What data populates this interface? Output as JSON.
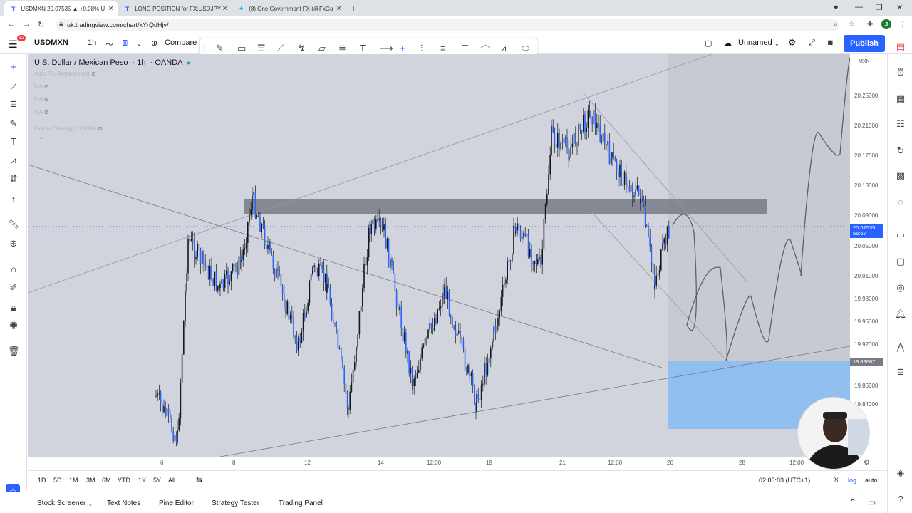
{
  "browser": {
    "tabs": [
      {
        "label": "USDMXN 20.07535 ▲ +0.08% U",
        "icon": "tradingview-icon",
        "active": true
      },
      {
        "label": "LONG POSITION for FX:USDJPY",
        "icon": "tradingview-icon",
        "active": false
      },
      {
        "label": "(8) One Government FX (@FxGo",
        "icon": "twitter-icon",
        "active": false
      }
    ],
    "url": "uk.tradingview.com/chart/xYrQdHjv/",
    "profile_initial": "J"
  },
  "toolbar": {
    "symbol": "USDMXN",
    "interval": "1h",
    "compare_label": "Compare",
    "layout_name": "Unnamed",
    "publish_label": "Publish",
    "alert_badge": "12"
  },
  "legend": {
    "title": "U.S. Dollar / Mexican Peso",
    "interval": "1h",
    "broker": "OANDA",
    "indicators": [
      "Auto Fib Retracement",
      "MA",
      "MA",
      "MA",
      "Indices Strategy(US100)"
    ]
  },
  "price_axis": {
    "currency": "MXN",
    "labels": [
      "20.25000",
      "20.21000",
      "20.17000",
      "20.13000",
      "20.09000",
      "20.05000",
      "20.01000",
      "19.98000",
      "19.95000",
      "19.92000",
      "19.86500",
      "19.84000",
      "19.80"
    ],
    "current_price": "20.07535",
    "countdown": "56:57",
    "level_tag": "19.89667",
    "current_color": "#2962ff",
    "level_color": "#787b86"
  },
  "time_axis": {
    "labels": [
      "6",
      "8",
      "12",
      "14",
      "12:00",
      "19",
      "21",
      "12:00",
      "26",
      "28",
      "12:00"
    ]
  },
  "range_bar": {
    "ranges": [
      "1D",
      "5D",
      "1M",
      "3M",
      "6M",
      "YTD",
      "1Y",
      "5Y",
      "All"
    ],
    "clock": "02:03:03 (UTC+1)",
    "percent": "%",
    "log": "log",
    "auto": "auto"
  },
  "panels": [
    "Stock Screener",
    "Text Notes",
    "Pine Editor",
    "Strategy Tester",
    "Trading Panel"
  ],
  "colors": {
    "candle": "#2962ff",
    "wick": "#131722",
    "zone": "#787b86",
    "box_blue": "#90bff0",
    "box_grey": "#c7c9cf"
  }
}
